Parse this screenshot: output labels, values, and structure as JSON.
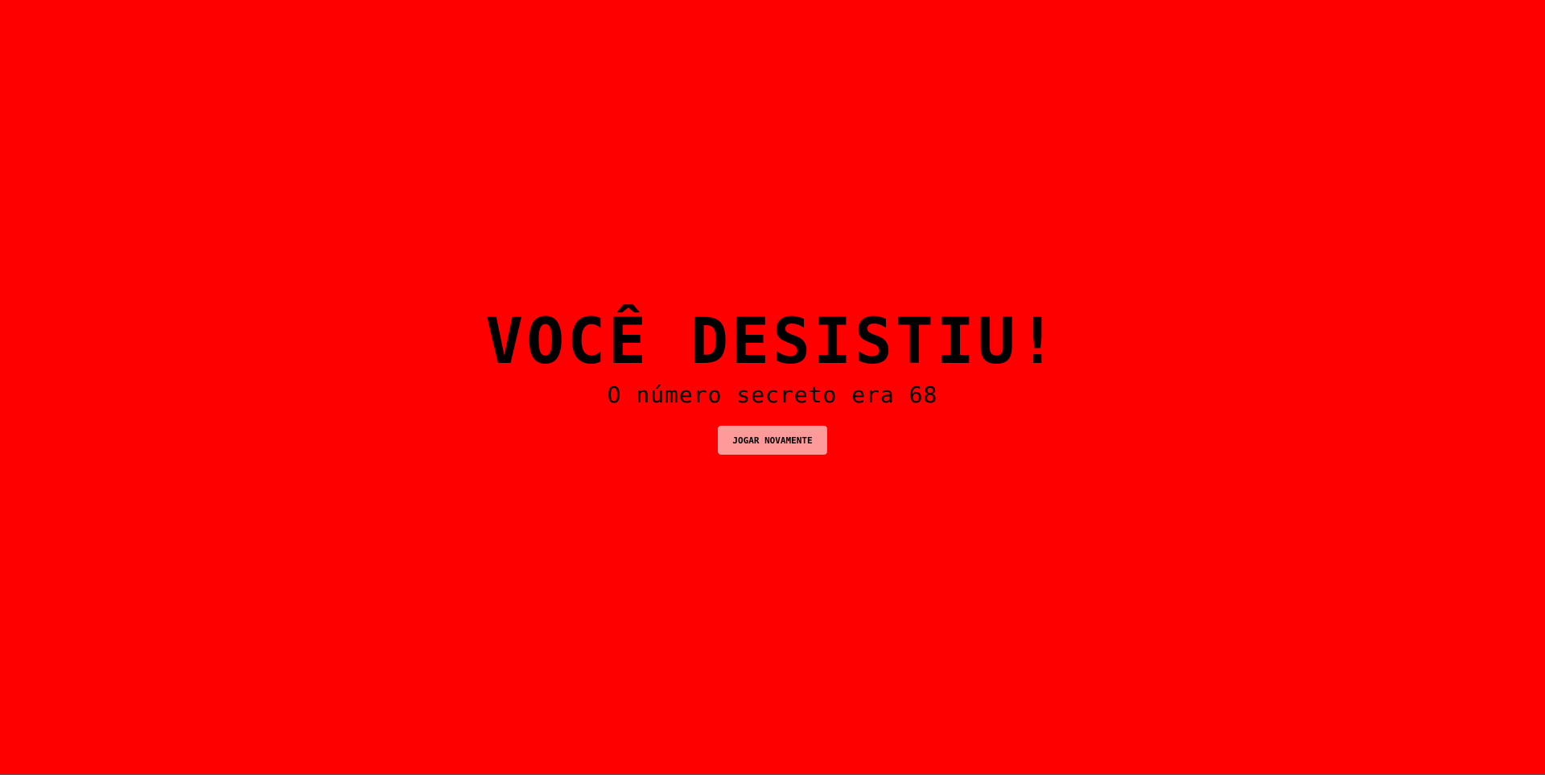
{
  "screen": {
    "background_color": "#ff0000",
    "text_color": "#000000",
    "button_color": "#ff9a9a"
  },
  "result": {
    "title": "VOCÊ DESISTIU!",
    "message": "O número secreto era 68",
    "replay_label": "JOGAR NOVAMENTE"
  }
}
